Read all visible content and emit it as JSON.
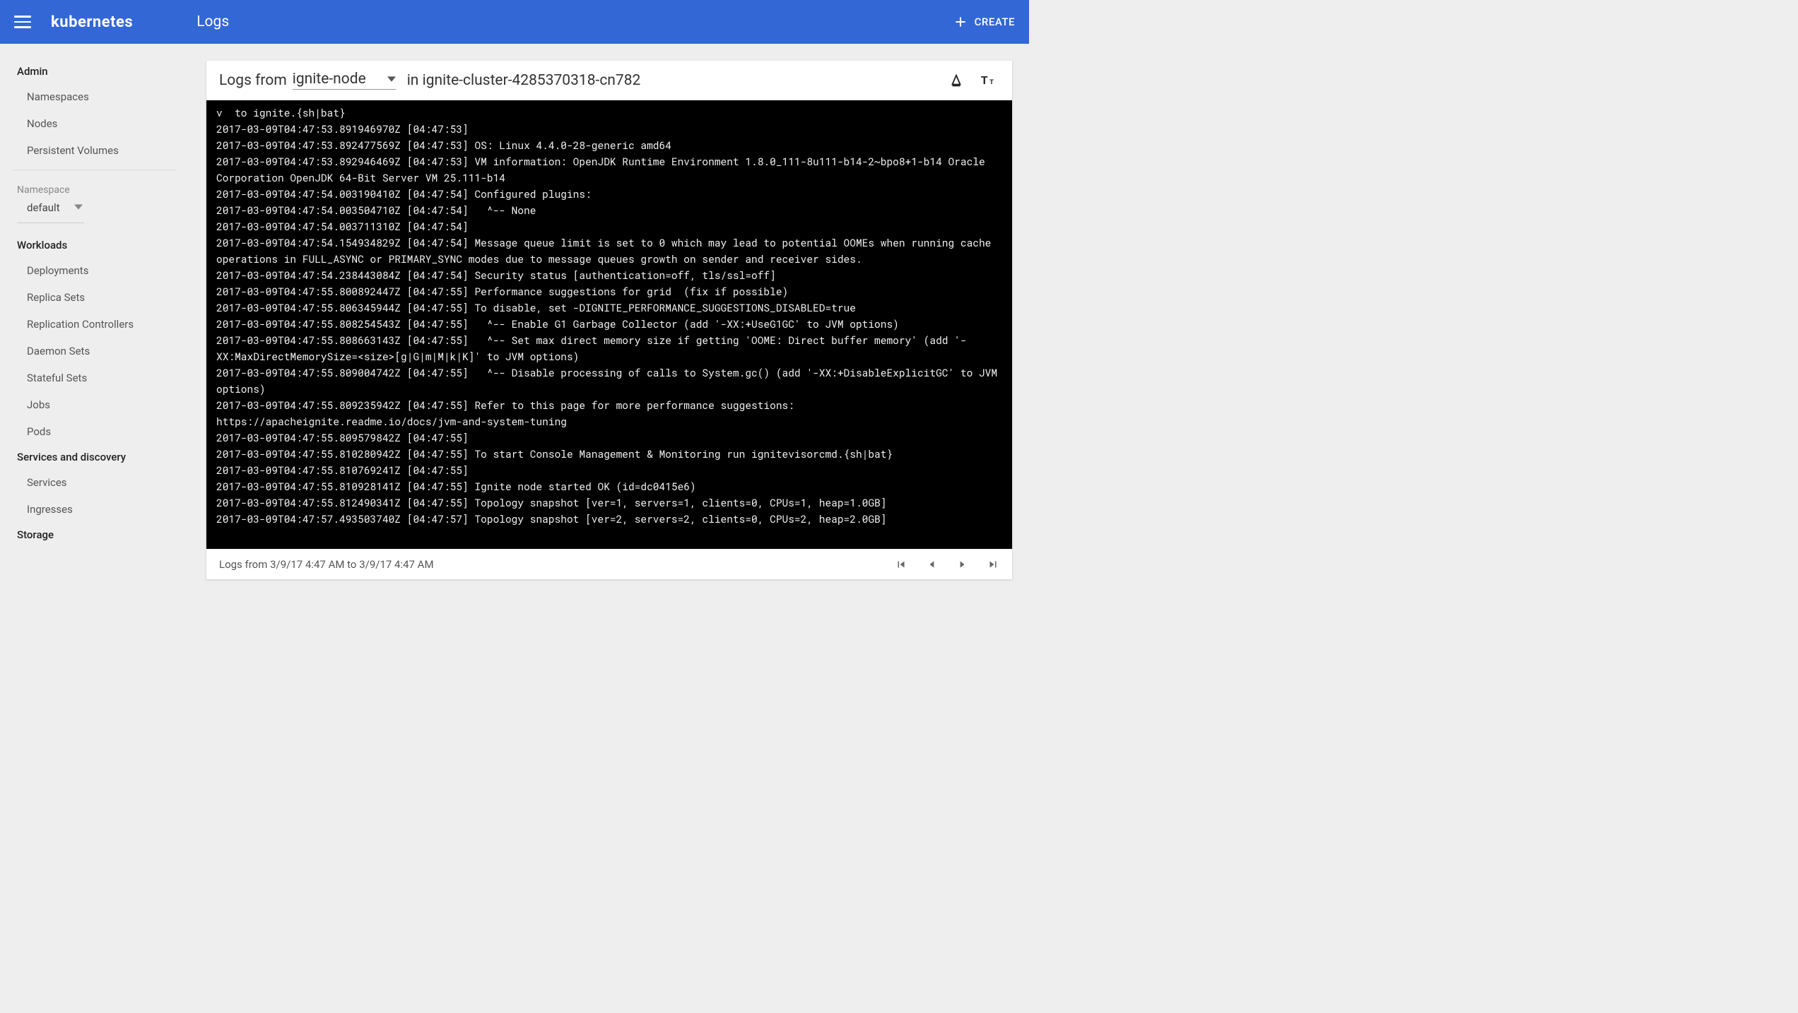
{
  "header": {
    "brand": "kubernetes",
    "page_title": "Logs",
    "create_label": "CREATE"
  },
  "sidebar": {
    "admin_head": "Admin",
    "admin_items": [
      "Namespaces",
      "Nodes",
      "Persistent Volumes"
    ],
    "namespace_label": "Namespace",
    "namespace_value": "default",
    "workloads_head": "Workloads",
    "workloads_items": [
      "Deployments",
      "Replica Sets",
      "Replication Controllers",
      "Daemon Sets",
      "Stateful Sets",
      "Jobs",
      "Pods"
    ],
    "services_head": "Services and discovery",
    "services_items": [
      "Services",
      "Ingresses"
    ],
    "storage_head": "Storage"
  },
  "log_toolbar": {
    "logs_from_label": "Logs from",
    "source": "ignite-node",
    "in_label": "in",
    "pod": "ignite-cluster-4285370318-cn782"
  },
  "log_lines": [
    "v  to ignite.{sh|bat}",
    "2017-03-09T04:47:53.891946970Z [04:47:53]",
    "2017-03-09T04:47:53.892477569Z [04:47:53] OS: Linux 4.4.0-28-generic amd64",
    "2017-03-09T04:47:53.892946469Z [04:47:53] VM information: OpenJDK Runtime Environment 1.8.0_111-8u111-b14-2~bpo8+1-b14 Oracle Corporation OpenJDK 64-Bit Server VM 25.111-b14",
    "2017-03-09T04:47:54.003190410Z [04:47:54] Configured plugins:",
    "2017-03-09T04:47:54.003504710Z [04:47:54]   ^-- None",
    "2017-03-09T04:47:54.003711310Z [04:47:54]",
    "2017-03-09T04:47:54.154934829Z [04:47:54] Message queue limit is set to 0 which may lead to potential OOMEs when running cache operations in FULL_ASYNC or PRIMARY_SYNC modes due to message queues growth on sender and receiver sides.",
    "2017-03-09T04:47:54.238443084Z [04:47:54] Security status [authentication=off, tls/ssl=off]",
    "2017-03-09T04:47:55.800892447Z [04:47:55] Performance suggestions for grid  (fix if possible)",
    "2017-03-09T04:47:55.806345944Z [04:47:55] To disable, set -DIGNITE_PERFORMANCE_SUGGESTIONS_DISABLED=true",
    "2017-03-09T04:47:55.808254543Z [04:47:55]   ^-- Enable G1 Garbage Collector (add '-XX:+UseG1GC' to JVM options)",
    "2017-03-09T04:47:55.808663143Z [04:47:55]   ^-- Set max direct memory size if getting 'OOME: Direct buffer memory' (add '-XX:MaxDirectMemorySize=<size>[g|G|m|M|k|K]' to JVM options)",
    "2017-03-09T04:47:55.809004742Z [04:47:55]   ^-- Disable processing of calls to System.gc() (add '-XX:+DisableExplicitGC' to JVM options)",
    "2017-03-09T04:47:55.809235942Z [04:47:55] Refer to this page for more performance suggestions: https://apacheignite.readme.io/docs/jvm-and-system-tuning",
    "2017-03-09T04:47:55.809579842Z [04:47:55]",
    "2017-03-09T04:47:55.810280942Z [04:47:55] To start Console Management & Monitoring run ignitevisorcmd.{sh|bat}",
    "2017-03-09T04:47:55.810769241Z [04:47:55]",
    "2017-03-09T04:47:55.810928141Z [04:47:55] Ignite node started OK (id=dc0415e6)",
    "2017-03-09T04:47:55.812490341Z [04:47:55] Topology snapshot [ver=1, servers=1, clients=0, CPUs=1, heap=1.0GB]",
    "2017-03-09T04:47:57.493503740Z [04:47:57] Topology snapshot [ver=2, servers=2, clients=0, CPUs=2, heap=2.0GB]"
  ],
  "log_footer": {
    "range_text": "Logs from 3/9/17 4:47 AM to 3/9/17 4:47 AM"
  }
}
